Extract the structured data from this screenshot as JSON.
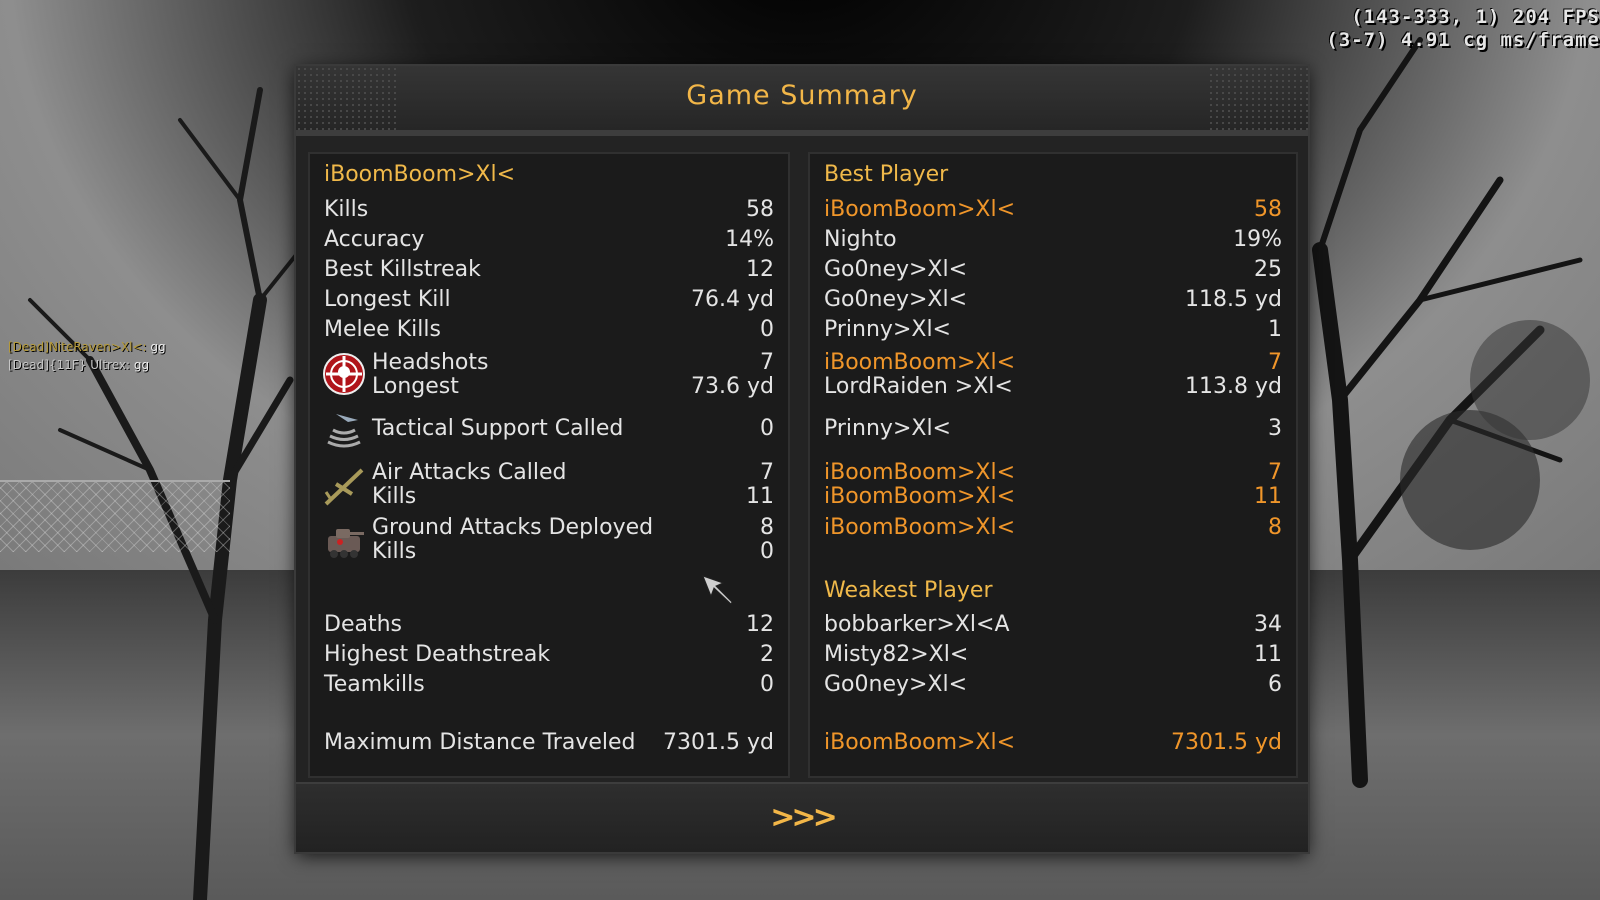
{
  "hud": {
    "line1": "(143-333, 1) 204 FPS",
    "line2": "(3-7) 4.91 cg ms/frame"
  },
  "chat": [
    {
      "tag": "[Dead]NiteRaven>Xl<",
      "sep": ": ",
      "msg": "gg"
    },
    {
      "tag": "[Dead]{11F} Ultrex",
      "sep": ": ",
      "msg": "gg"
    }
  ],
  "title": "Game Summary",
  "player": "iBoomBoom>Xl<",
  "stats": {
    "kills": {
      "label": "Kills",
      "value": "58"
    },
    "accuracy": {
      "label": "Accuracy",
      "value": "14%"
    },
    "best_killstreak": {
      "label": "Best Killstreak",
      "value": "12"
    },
    "longest_kill": {
      "label": "Longest Kill",
      "value": "76.4 yd"
    },
    "melee_kills": {
      "label": "Melee Kills",
      "value": "0"
    },
    "headshots": {
      "label": "Headshots",
      "value": "7"
    },
    "headshot_longest": {
      "label": "Longest",
      "value": "73.6 yd"
    },
    "tactical": {
      "label": "Tactical Support Called",
      "value": "0"
    },
    "air_called": {
      "label": "Air Attacks Called",
      "value": "7"
    },
    "air_kills": {
      "label": "Kills",
      "value": "11"
    },
    "ground_deployed": {
      "label": "Ground Attacks Deployed",
      "value": "8"
    },
    "ground_kills": {
      "label": "Kills",
      "value": "0"
    },
    "deaths": {
      "label": "Deaths",
      "value": "12"
    },
    "highest_deathstreak": {
      "label": "Highest Deathstreak",
      "value": "2"
    },
    "teamkills": {
      "label": "Teamkills",
      "value": "0"
    },
    "max_distance": {
      "label": "Maximum Distance Traveled",
      "value": "7301.5 yd"
    }
  },
  "best": {
    "heading": "Best Player",
    "kills": {
      "name": "iBoomBoom>Xl<",
      "value": "58"
    },
    "accuracy": {
      "name": "Nighto",
      "value": "19%"
    },
    "best_killstreak": {
      "name": "Go0ney>Xl<",
      "value": "25"
    },
    "longest_kill": {
      "name": "Go0ney>Xl<",
      "value": "118.5 yd"
    },
    "melee_kills": {
      "name": "Prinny>Xl<",
      "value": "1"
    },
    "headshots": {
      "name": "iBoomBoom>Xl<",
      "value": "7"
    },
    "headshot_longest": {
      "name": "LordRaiden >Xl<",
      "value": "113.8 yd"
    },
    "tactical": {
      "name": "Prinny>Xl<",
      "value": "3"
    },
    "air_called": {
      "name": "iBoomBoom>Xl<",
      "value": "7"
    },
    "air_kills": {
      "name": "iBoomBoom>Xl<",
      "value": "11"
    },
    "ground_deployed": {
      "name": "iBoomBoom>Xl<",
      "value": "8"
    },
    "max_distance": {
      "name": "iBoomBoom>Xl<",
      "value": "7301.5 yd"
    }
  },
  "weakest": {
    "heading": "Weakest Player",
    "deaths": {
      "name": "bobbarker>Xl<A",
      "value": "34"
    },
    "highest_deathstreak": {
      "name": "Misty82>Xl<",
      "value": "11"
    },
    "teamkills": {
      "name": "Go0ney>Xl<",
      "value": "6"
    }
  },
  "next_label": ">>>",
  "colors": {
    "gold": "#f0b94a",
    "orange": "#f0962a",
    "panel": "#232323"
  }
}
